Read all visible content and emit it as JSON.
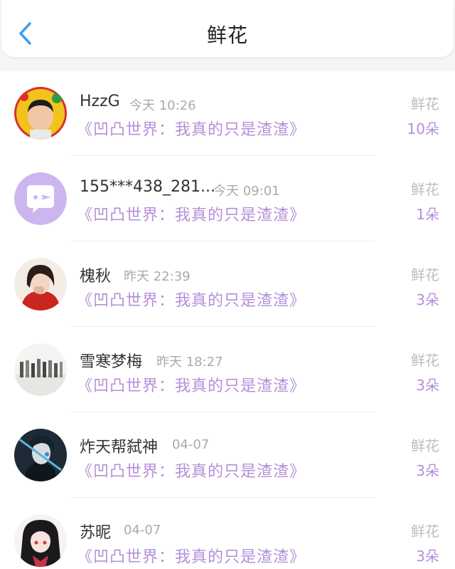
{
  "header": {
    "title": "鲜花",
    "back_icon": "chevron-left-icon"
  },
  "colors": {
    "accent": "#b48fd8",
    "back": "#3aa0f0",
    "avatar_purple": "#cdb6ef"
  },
  "items": [
    {
      "name": "HzzG",
      "time": "今天 10:26",
      "book": "《凹凸世界：我真的只是渣渣》",
      "gift": "鲜花",
      "count": "10朵"
    },
    {
      "name": "155***438_281...",
      "time": "今天 09:01",
      "book": "《凹凸世界：我真的只是渣渣》",
      "gift": "鲜花",
      "count": "1朵"
    },
    {
      "name": "槐秋",
      "time": "昨天 22:39",
      "book": "《凹凸世界：我真的只是渣渣》",
      "gift": "鲜花",
      "count": "3朵"
    },
    {
      "name": "雪寒梦梅",
      "time": "昨天 18:27",
      "book": "《凹凸世界：我真的只是渣渣》",
      "gift": "鲜花",
      "count": "3朵"
    },
    {
      "name": "炸天帮弑神",
      "time": "04-07",
      "book": "《凹凸世界：我真的只是渣渣》",
      "gift": "鲜花",
      "count": "3朵"
    },
    {
      "name": "苏昵",
      "time": "04-07",
      "book": "《凹凸世界：我真的只是渣渣》",
      "gift": "鲜花",
      "count": "3朵"
    }
  ]
}
